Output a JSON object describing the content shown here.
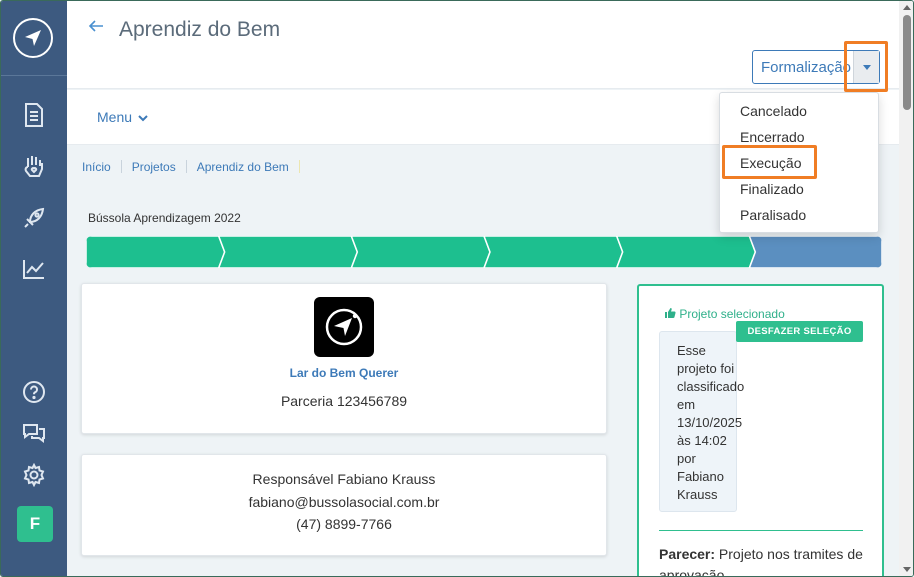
{
  "header": {
    "title": "Aprendiz do Bem",
    "status_button_label": "Formalização"
  },
  "subnav": {
    "menu_label": "Menu"
  },
  "breadcrumb": [
    "Início",
    "Projetos",
    "Aprendiz do Bem"
  ],
  "program": {
    "name": "Bússola Aprendizagem 2022",
    "steps_total": 6,
    "steps_completed": 5,
    "colors": {
      "done": "#1dbf8f",
      "current": "#5b8fc0"
    }
  },
  "organization": {
    "name": "Lar do Bem Querer",
    "partnership": "Parceria 123456789"
  },
  "contact": {
    "responsible": "Responsável Fabiano Krauss",
    "email": "fabiano@bussolasocial.com.br",
    "phone": "(47) 8899-7766"
  },
  "selection": {
    "label": "Projeto selecionado",
    "undo_button": "DESFAZER SELEÇÃO",
    "classification_lines": [
      "Esse",
      "projeto foi",
      "classificado",
      "em",
      "13/10/2025",
      "às 14:02",
      "por",
      "Fabiano",
      "Krauss"
    ],
    "parecer_label": "Parecer:",
    "parecer_text": " Projeto nos tramites de aprovação"
  },
  "status_dropdown": {
    "options": [
      "Cancelado",
      "Encerrado",
      "Execução",
      "Finalizado",
      "Paralisado"
    ],
    "highlighted": "Execução"
  },
  "sidebar": {
    "avatar_initial": "F"
  },
  "colors": {
    "sidebar": "#3d5a80",
    "accent": "#3d7ab8",
    "green": "#2fbf8f",
    "highlight": "#f07d24"
  }
}
